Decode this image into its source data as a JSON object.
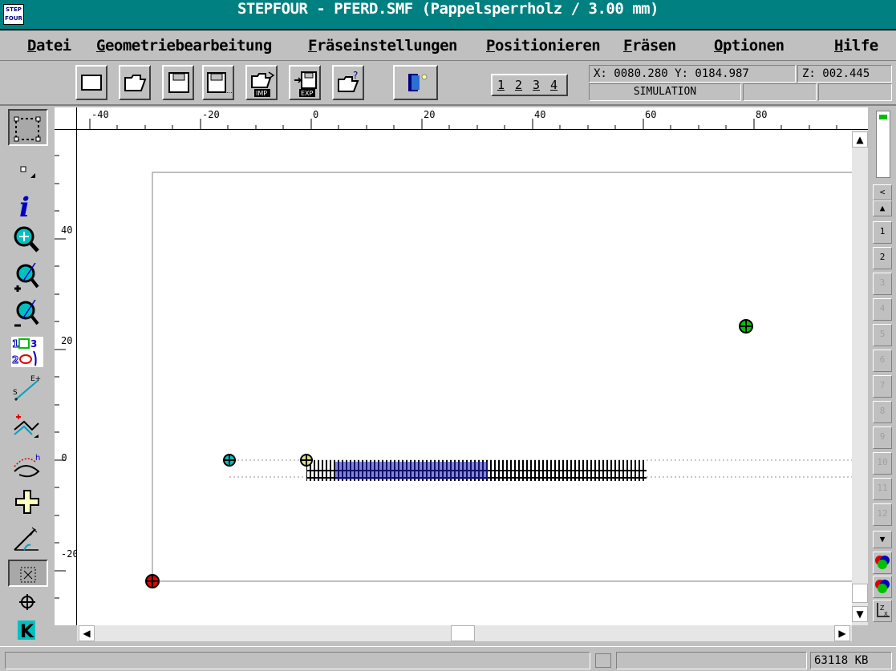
{
  "app": {
    "icon_text_1": "STEP",
    "icon_text_2": "FOUR",
    "title": "STEPFOUR - PFERD.SMF (Pappelsperrholz / 3.00 mm)"
  },
  "menu": {
    "datei": "Datei",
    "geometrie": "Geometriebearbeitung",
    "fraeseinst": "Fräseinstellungen",
    "positionieren": "Positionieren",
    "fraesen": "Fräsen",
    "optionen": "Optionen",
    "hilfe": "Hilfe"
  },
  "toolbar": {
    "imp_label": "IMP",
    "exp_label": "EXP",
    "pages": [
      "1",
      "2",
      "3",
      "4"
    ],
    "coord_xy": "X: 0080.280 Y: 0184.987",
    "coord_z": "Z: 002.445",
    "mode": "SIMULATION"
  },
  "ruler": {
    "top": [
      "-40",
      "-20",
      "0",
      "20",
      "40",
      "60",
      "80"
    ],
    "left": [
      "40",
      "20",
      "0",
      "-20"
    ]
  },
  "layers": [
    "1",
    "2",
    "3",
    "4",
    "5",
    "6",
    "7",
    "8",
    "9",
    "10",
    "11",
    "12"
  ],
  "left_tools": {
    "k_label": "K"
  },
  "status": {
    "memory": "63118 KB"
  },
  "colors": {
    "titlebar": "#008080",
    "window": "#c0c0c0",
    "canvas": "#ffffff"
  }
}
